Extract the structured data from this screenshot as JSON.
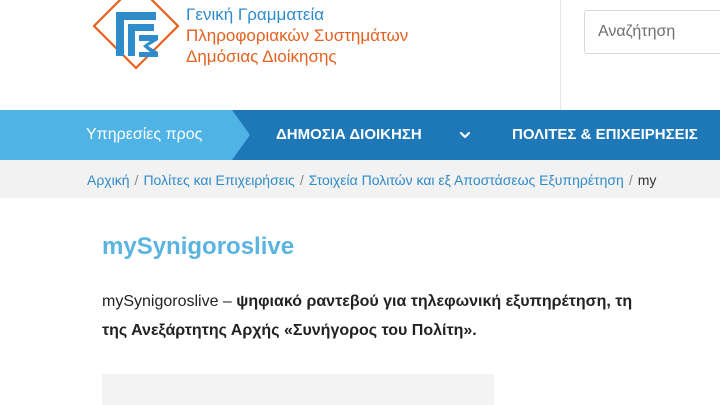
{
  "header": {
    "logo": {
      "line1": "Γενική Γραμματεία",
      "line2": "Πληροφοριακών Συστημάτων",
      "line3": "Δημόσιας Διοίκησης",
      "colors": {
        "blue": "#2f8bc9",
        "orange": "#e4611f"
      }
    },
    "search": {
      "placeholder": "Αναζήτηση"
    }
  },
  "nav": {
    "intro_label": "Υπηρεσίες προς",
    "items": [
      {
        "label": "ΔΗΜΟΣΙΑ ΔΙΟΙΚΗΣΗ",
        "icon": "chevron-down-icon"
      },
      {
        "label": "ΠΟΛΙΤΕΣ & ΕΠΙΧΕΙΡΗΣΕΙΣ"
      }
    ],
    "colors": {
      "bar": "#1e78b8",
      "intro": "#4fb3e6"
    }
  },
  "breadcrumb": {
    "items": [
      "Αρχική",
      "Πολίτες και Επιχειρήσεις",
      "Στοιχεία Πολιτών και εξ Αποστάσεως Εξυπηρέτηση"
    ],
    "current": "my"
  },
  "content": {
    "title": "mySynigoroslive",
    "para_line1_plain": "mySynigoroslive – ",
    "para_line1_bold": "ψηφιακό ραντεβού για τηλεφωνική εξυπηρέτηση, τη",
    "para_line2_bold": "της  Ανεξάρτητης Αρχής «Συνήγορος του Πολίτη».",
    "title_color": "#5bb4e0"
  }
}
